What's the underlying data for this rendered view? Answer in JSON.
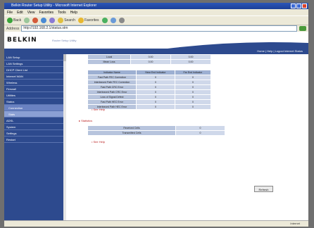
{
  "browser": {
    "title": "Belkin Router Setup Utility - Microsoft Internet Explorer",
    "menu": [
      "File",
      "Edit",
      "View",
      "Favorites",
      "Tools",
      "Help"
    ],
    "toolbar": {
      "back": "Back",
      "search": "Search",
      "favorites": "Favorites"
    },
    "address_label": "Address",
    "address_value": "http://192.168.2.1/status.stm",
    "status_text": "Internet"
  },
  "header": {
    "logo": "BELKIN",
    "tagline": "Router Setup Utility",
    "links": "Home | Help | Logout   Internet Status"
  },
  "sidebar": {
    "items": [
      {
        "label": "LAN Setup"
      },
      {
        "label": "LAN Settings"
      },
      {
        "label": "DHCP Client List"
      },
      {
        "label": "Internet WAN"
      },
      {
        "label": "Wireless"
      },
      {
        "label": "Firewall"
      },
      {
        "label": "Utilities"
      },
      {
        "label": "Status"
      },
      {
        "label": "Connection"
      },
      {
        "label": "Stats"
      },
      {
        "label": "ADSL"
      },
      {
        "label": "System"
      },
      {
        "label": "Settings"
      },
      {
        "label": "Restart"
      }
    ]
  },
  "tables": {
    "top": {
      "rows": [
        {
          "label": "Local",
          "col1": "0.00",
          "col2": "0.00"
        },
        {
          "label": "Mean Loss",
          "col1": "0.00",
          "col2": "0.00"
        }
      ]
    },
    "errors": {
      "headers": [
        "Indicator Name",
        "Near End Indicator",
        "Far End Indicator"
      ],
      "rows": [
        {
          "label": "Fast Path FEC Correction",
          "near": "0",
          "far": "0"
        },
        {
          "label": "Interleaved Path FEC Correction",
          "near": "0",
          "far": "0"
        },
        {
          "label": "Fast Path CRC Error",
          "near": "0",
          "far": "0"
        },
        {
          "label": "Interleaved Path CRC Error",
          "near": "0",
          "far": "0"
        },
        {
          "label": "Loss of Signal Defect",
          "near": "0",
          "far": "0"
        },
        {
          "label": "Fast Path HEC Error",
          "near": "0",
          "far": "0"
        },
        {
          "label": "Interleaved Path HEC Error",
          "near": "0",
          "far": "0"
        }
      ],
      "link": "• See Help"
    },
    "stats": {
      "title": "▸ Statistics",
      "rows": [
        {
          "label": "Received Cells",
          "value": "0"
        },
        {
          "label": "Transmitted Cells",
          "value": "0"
        }
      ],
      "link": "• See Help"
    }
  },
  "buttons": {
    "refresh": "Refresh"
  }
}
